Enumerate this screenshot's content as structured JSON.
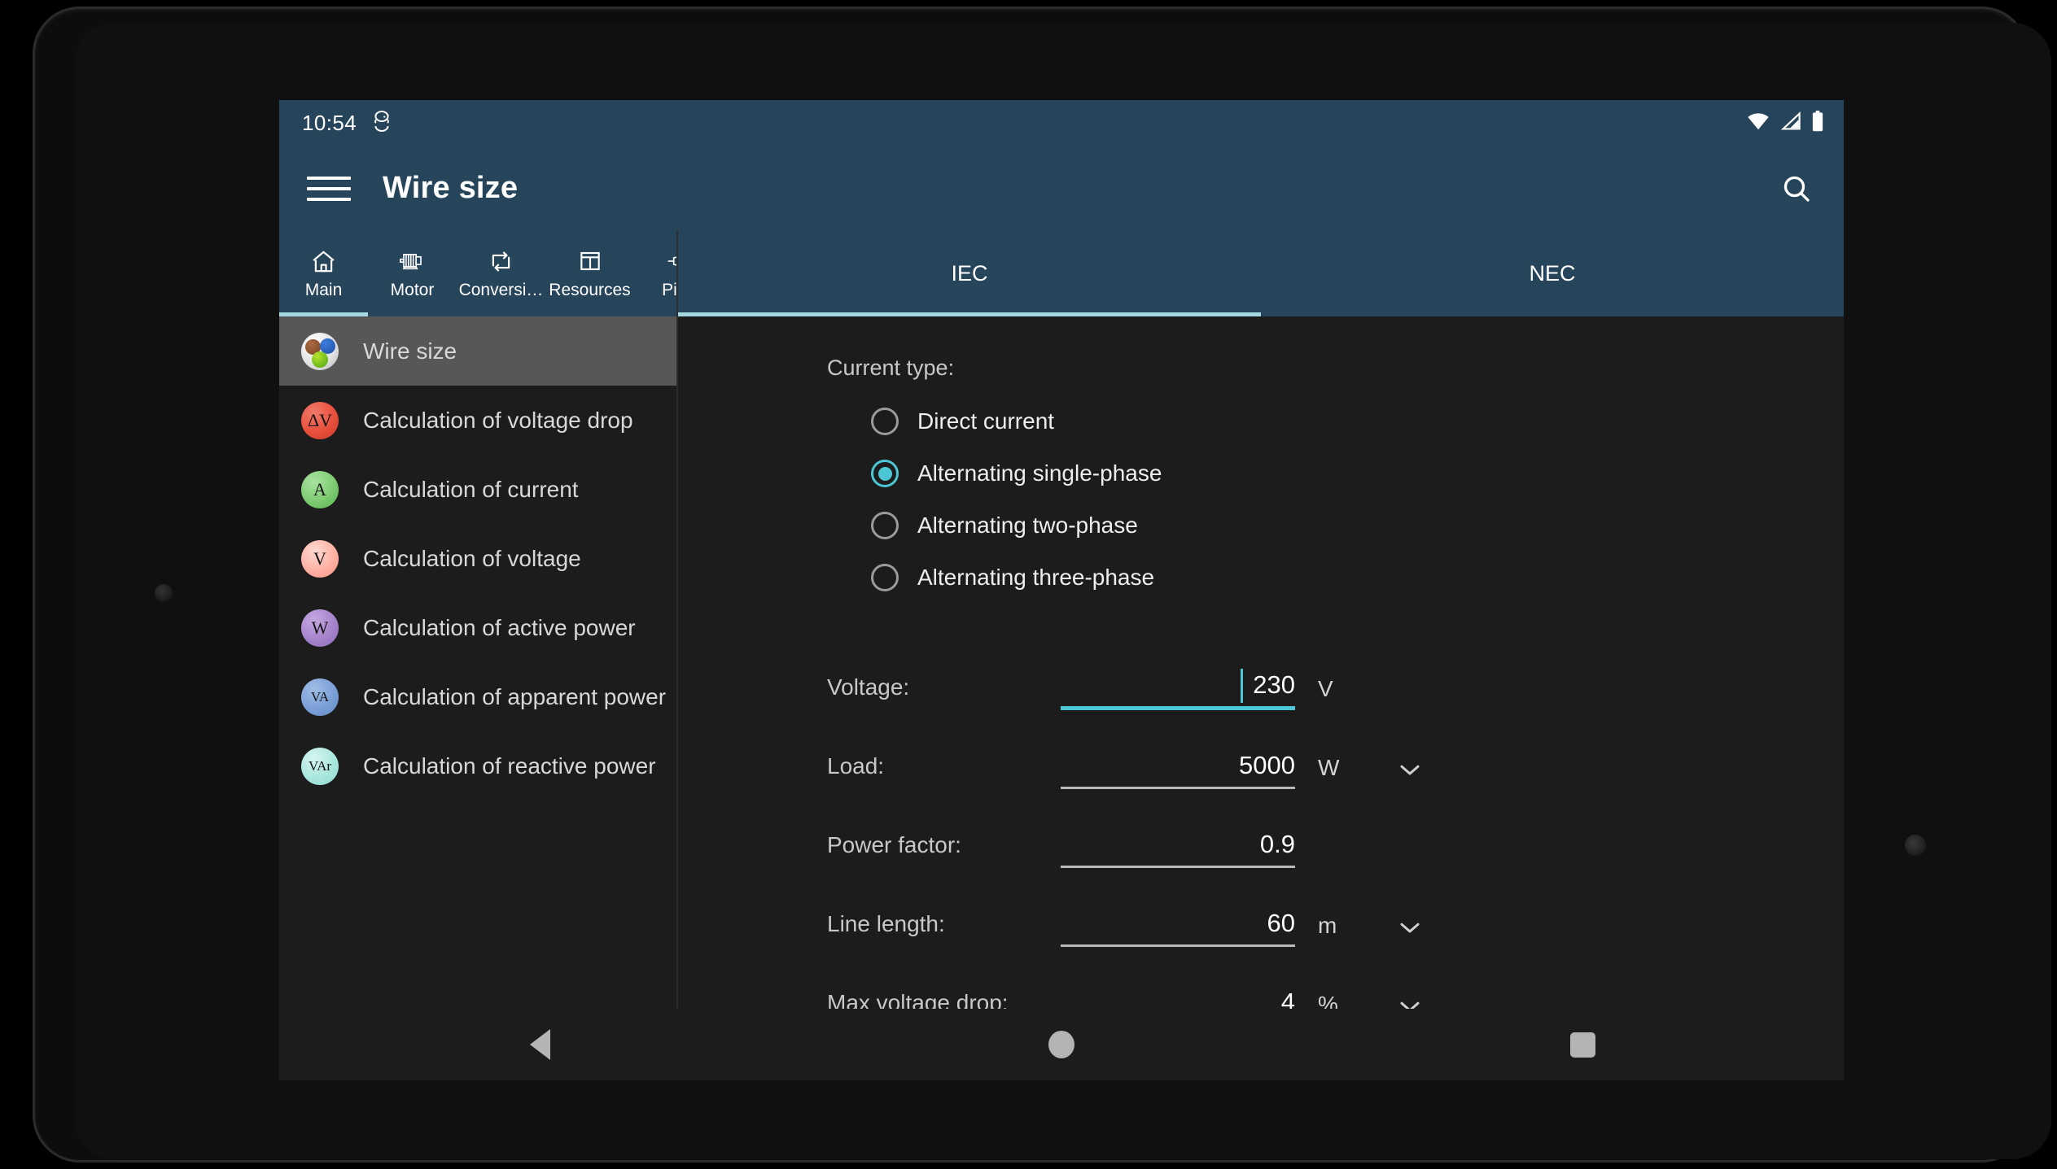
{
  "status_bar": {
    "time": "10:54",
    "icons": [
      "android-alarm-icon",
      "wifi-icon",
      "cellular-signal-icon",
      "battery-icon"
    ]
  },
  "app_bar": {
    "title": "Wire size",
    "menu_icon": "hamburger-menu-icon",
    "search_icon": "search-icon"
  },
  "tabs": [
    {
      "label": "Main",
      "icon": "home-icon",
      "active": true
    },
    {
      "label": "Motor",
      "icon": "motor-icon",
      "active": false
    },
    {
      "label": "Conversi…",
      "icon": "convert-icon",
      "active": false
    },
    {
      "label": "Resources",
      "icon": "table-icon",
      "active": false
    },
    {
      "label": "Pinc",
      "icon": "plug-icon",
      "active": false
    }
  ],
  "sidebar": {
    "items": [
      {
        "label": "Wire size",
        "badge": "",
        "selected": true
      },
      {
        "label": "Calculation of voltage drop",
        "badge": "ΔV",
        "selected": false
      },
      {
        "label": "Calculation of current",
        "badge": "A",
        "selected": false
      },
      {
        "label": "Calculation of voltage",
        "badge": "V",
        "selected": false
      },
      {
        "label": "Calculation of active power",
        "badge": "W",
        "selected": false
      },
      {
        "label": "Calculation of apparent power",
        "badge": "VA",
        "selected": false
      },
      {
        "label": "Calculation of reactive power",
        "badge": "VAr",
        "selected": false
      }
    ]
  },
  "standard_tabs": [
    {
      "label": "IEC",
      "active": true
    },
    {
      "label": "NEC",
      "active": false
    }
  ],
  "form": {
    "current_type_label": "Current type:",
    "current_type_options": [
      {
        "label": "Direct current",
        "checked": false
      },
      {
        "label": "Alternating single-phase",
        "checked": true
      },
      {
        "label": "Alternating two-phase",
        "checked": false
      },
      {
        "label": "Alternating three-phase",
        "checked": false
      }
    ],
    "fields": [
      {
        "label": "Voltage:",
        "value": "230",
        "unit": "V",
        "has_dropdown": false,
        "focused": true
      },
      {
        "label": "Load:",
        "value": "5000",
        "unit": "W",
        "has_dropdown": true,
        "focused": false
      },
      {
        "label": "Power factor:",
        "value": "0.9",
        "unit": "",
        "has_dropdown": false,
        "focused": false
      },
      {
        "label": "Line length:",
        "value": "60",
        "unit": "m",
        "has_dropdown": true,
        "focused": false
      },
      {
        "label": "Max voltage drop:",
        "value": "4",
        "unit": "%",
        "has_dropdown": true,
        "focused": false
      }
    ]
  },
  "nav_bar": {
    "back": "back-icon",
    "home": "home-circle-icon",
    "recent": "recent-apps-icon"
  },
  "colors": {
    "app_bar": "#27455a",
    "accent": "#4cc6d4",
    "tab_indicator": "#a5d9df",
    "screen_background": "#1c1c1c",
    "selected_item": "#575757"
  }
}
